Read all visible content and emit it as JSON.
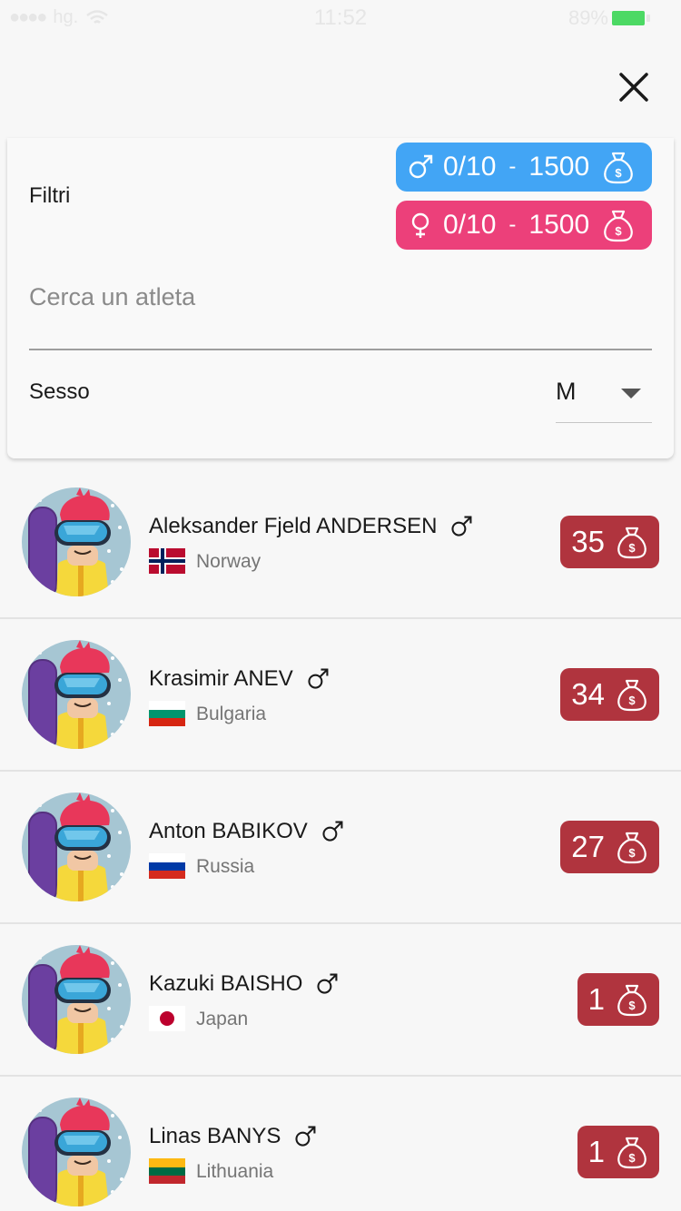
{
  "status_bar": {
    "carrier": "hg.",
    "time": "11:52",
    "battery": "89%"
  },
  "filters": {
    "label": "Filtri",
    "male_budget": {
      "count": "0/10",
      "separator": "-",
      "credits": "1500"
    },
    "female_budget": {
      "count": "0/10",
      "separator": "-",
      "credits": "1500"
    },
    "search_placeholder": "Cerca un atleta",
    "sex_label": "Sesso",
    "sex_value": "M"
  },
  "athletes": [
    {
      "name": "Aleksander Fjeld ANDERSEN",
      "country": "Norway",
      "price": "35"
    },
    {
      "name": "Krasimir ANEV",
      "country": "Bulgaria",
      "price": "34"
    },
    {
      "name": "Anton BABIKOV",
      "country": "Russia",
      "price": "27"
    },
    {
      "name": "Kazuki BAISHO",
      "country": "Japan",
      "price": "1"
    },
    {
      "name": "Linas BANYS",
      "country": "Lithuania",
      "price": "1"
    }
  ],
  "colors": {
    "male_pill": "#42a5f5",
    "female_pill": "#ec407a",
    "price_badge": "#b0343e"
  }
}
